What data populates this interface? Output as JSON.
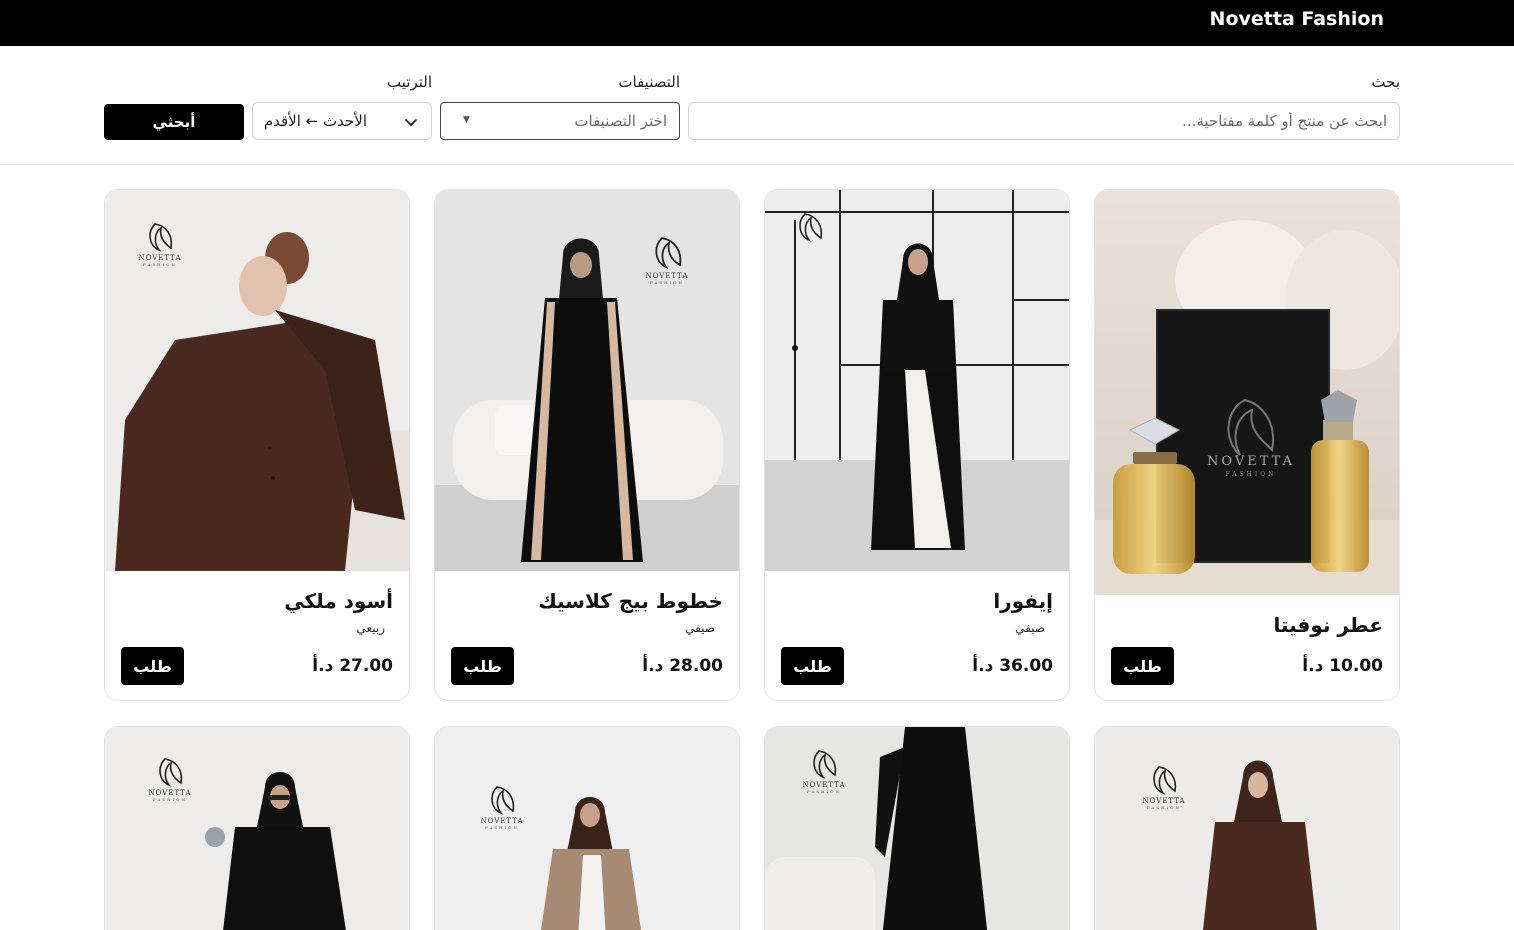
{
  "brand": "Novetta Fashion",
  "filters": {
    "search_label": "بحث",
    "search_placeholder": "ابحث عن منتج أو كلمة مفتاحية...",
    "categories_label": "التصنيفات",
    "categories_placeholder": "اختر التصنيفات",
    "sort_label": "الترتيب",
    "sort_value": "الأحدث ← الأقدم",
    "search_button": "أبحثي"
  },
  "logo_text": "NOVETTA",
  "logo_sub": "FASHION",
  "currency_note": "د.أ",
  "products": [
    {
      "name": "عطر نوفيتا",
      "category": "",
      "price": "10.00 د.أ",
      "order_label": "طلب"
    },
    {
      "name": "إيفورا",
      "category": "صيفي",
      "price": "36.00 د.أ",
      "order_label": "طلب"
    },
    {
      "name": "خطوط بيج كلاسيك",
      "category": "صيفي",
      "price": "28.00 د.أ",
      "order_label": "طلب"
    },
    {
      "name": "أسود ملكي",
      "category": "ربيعي",
      "price": "27.00 د.أ",
      "order_label": "طلب"
    }
  ]
}
